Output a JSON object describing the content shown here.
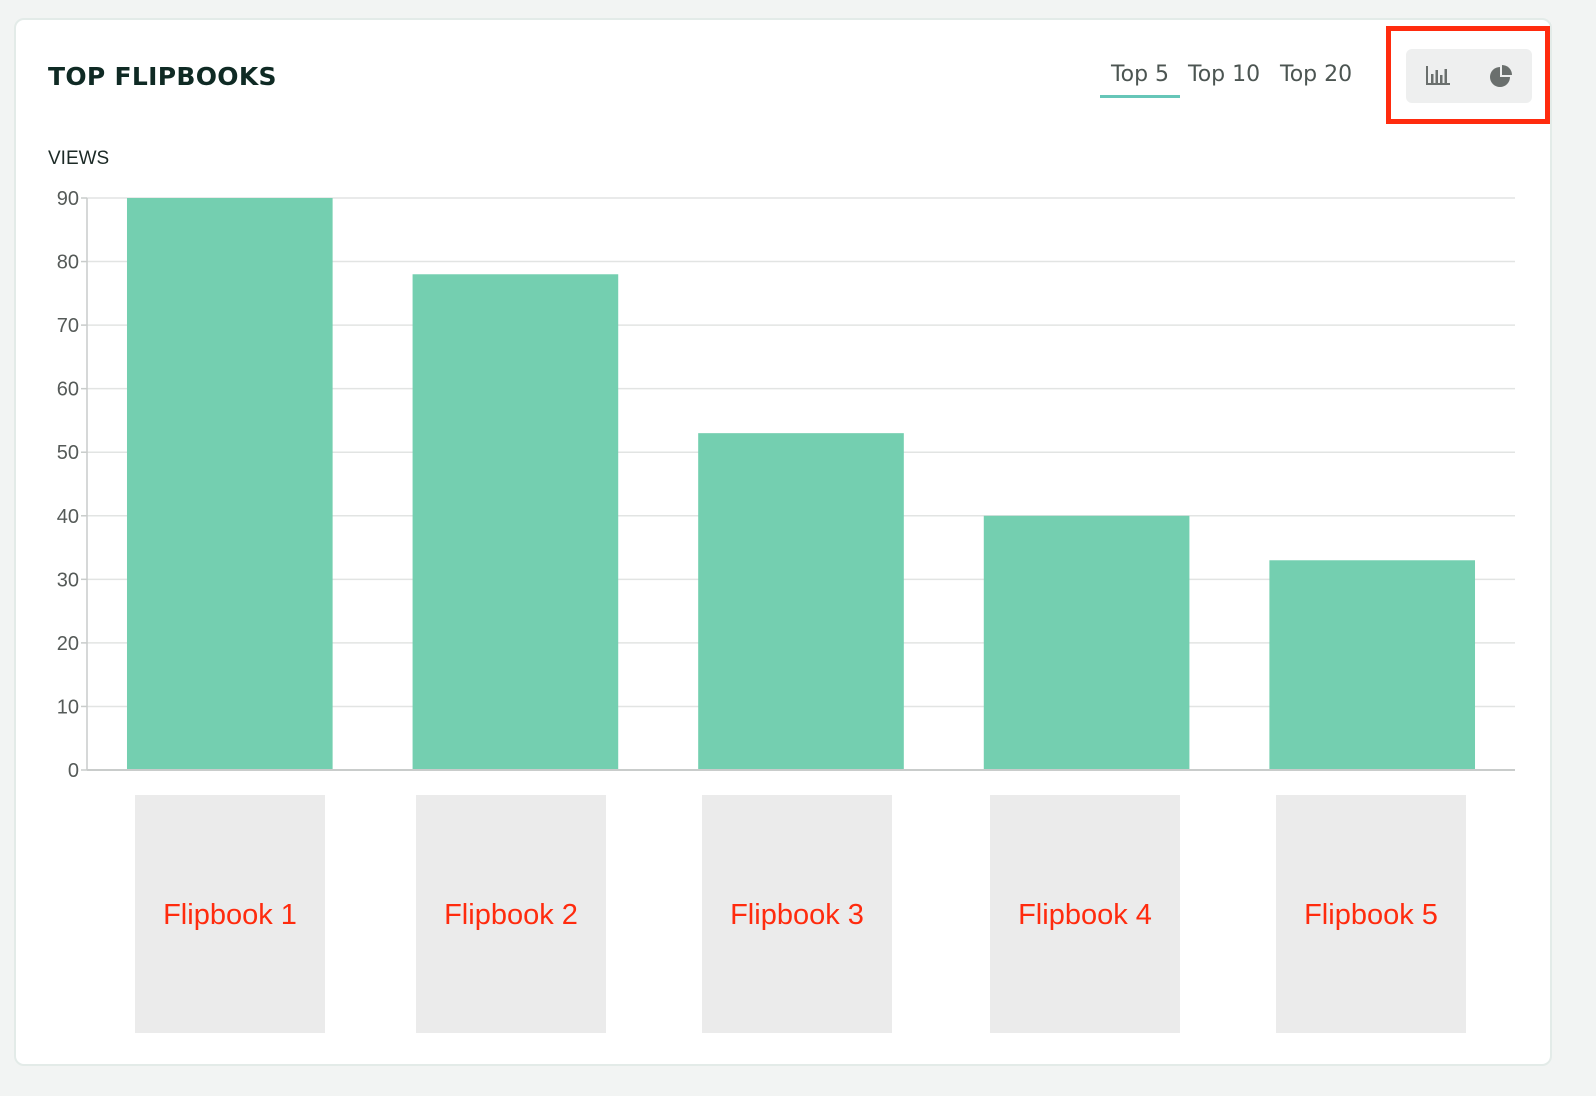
{
  "card": {
    "title": "TOP FLIPBOOKS",
    "tabs": [
      {
        "label": "Top 5",
        "active": true
      },
      {
        "label": "Top 10",
        "active": false
      },
      {
        "label": "Top 20",
        "active": false
      }
    ],
    "view_toggle": {
      "bar_icon": "bar-chart-icon",
      "pie_icon": "pie-chart-icon",
      "highlight_color": "#ff2b0e"
    }
  },
  "chart_data": {
    "type": "bar",
    "ylabel": "VIEWS",
    "categories": [
      "Flipbook 1",
      "Flipbook 2",
      "Flipbook 3",
      "Flipbook 4",
      "Flipbook 5"
    ],
    "values": [
      90,
      78,
      53,
      40,
      33
    ],
    "ylim": [
      0,
      90
    ],
    "yticks": [
      0,
      10,
      20,
      30,
      40,
      50,
      60,
      70,
      80,
      90
    ],
    "grid": true,
    "bar_color": "#74cfb0"
  },
  "thumbnails": [
    {
      "label": "Flipbook 1"
    },
    {
      "label": "Flipbook 2"
    },
    {
      "label": "Flipbook 3"
    },
    {
      "label": "Flipbook 4"
    },
    {
      "label": "Flipbook 5"
    }
  ],
  "colors": {
    "accent": "#66c6b8",
    "bar": "#74cfb0",
    "label_red": "#ff2b0e",
    "thumbnail_bg": "#ebebeb"
  }
}
